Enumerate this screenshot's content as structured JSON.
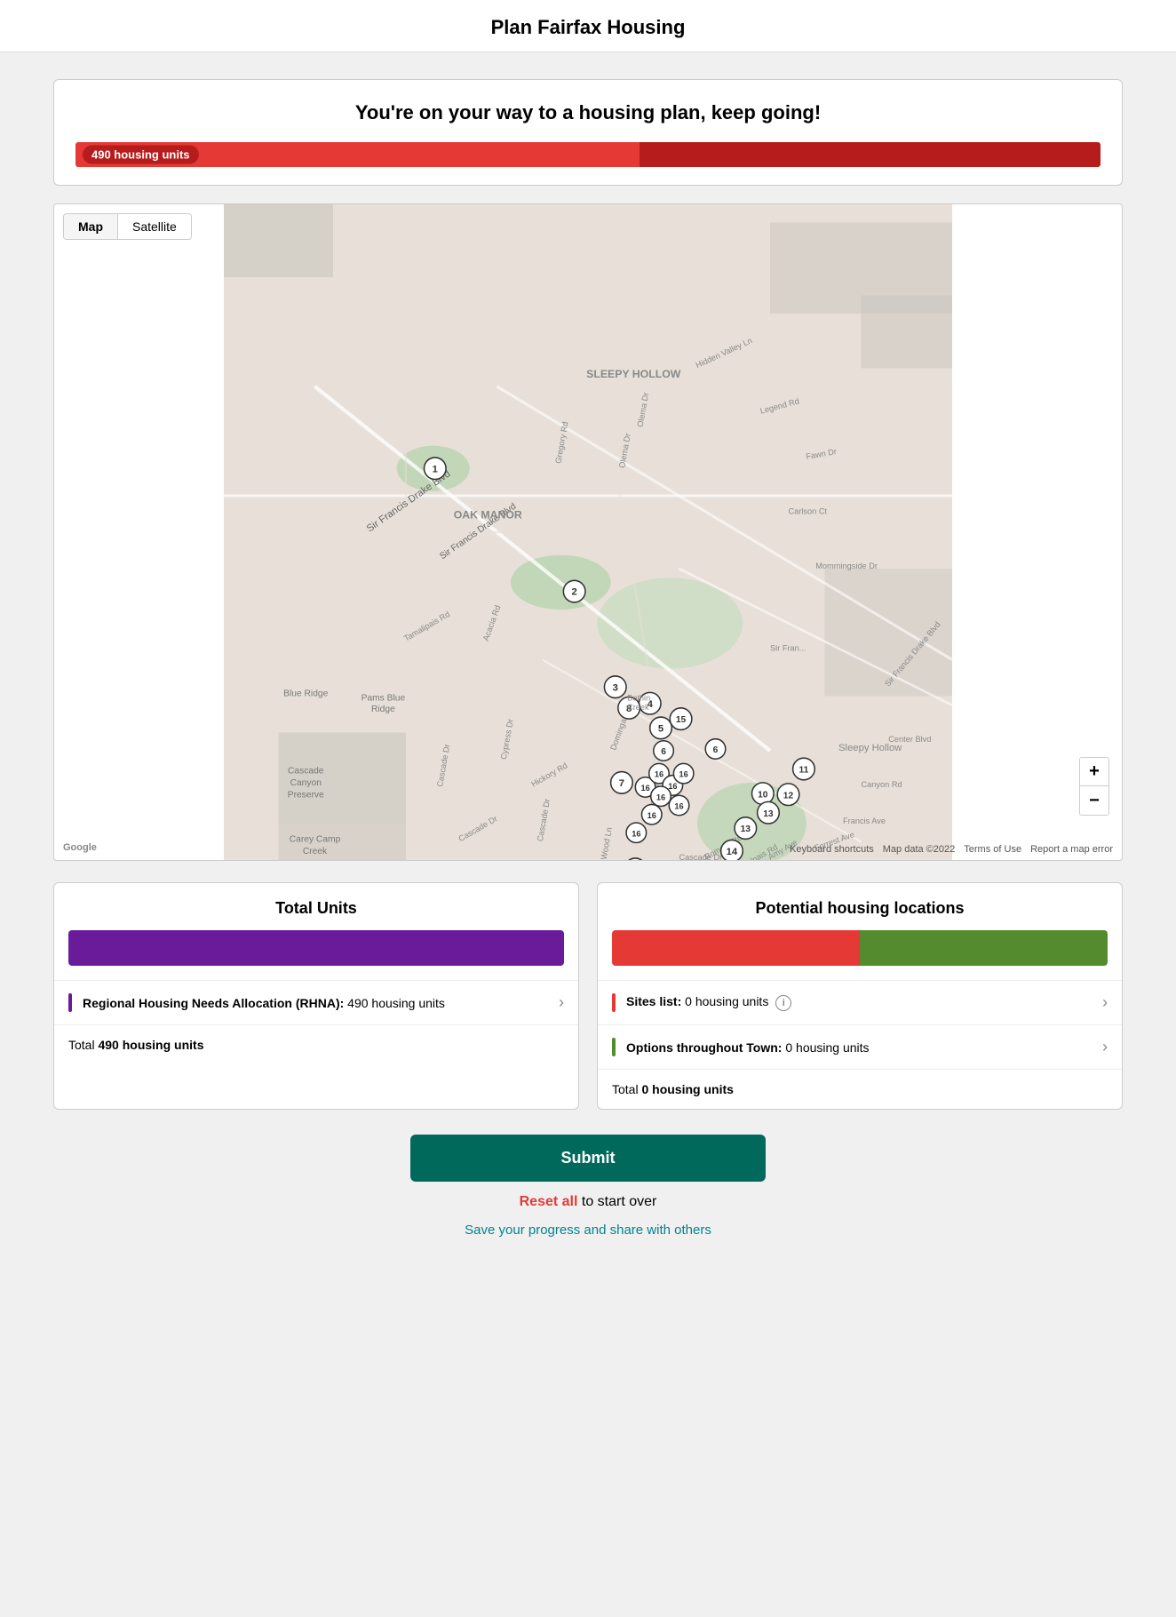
{
  "page": {
    "title": "Plan Fairfax Housing"
  },
  "progress_card": {
    "title": "You're on your way to a housing plan, keep going!",
    "label": "490 housing units"
  },
  "map": {
    "tab_map": "Map",
    "tab_satellite": "Satellite",
    "zoom_in": "+",
    "zoom_out": "−",
    "footer_shortcuts": "Keyboard shortcuts",
    "footer_data": "Map data ©2022",
    "footer_terms": "Terms of Use",
    "footer_error": "Report a map error",
    "google_logo": "Google"
  },
  "total_units": {
    "title": "Total Units",
    "rhna_label": "Regional Housing Needs Allocation (RHNA):",
    "rhna_value": "490 housing units",
    "total_label": "Total",
    "total_value": "490 housing units",
    "arrow": "›"
  },
  "potential_housing": {
    "title": "Potential housing locations",
    "sites_label": "Sites list:",
    "sites_value": "0 housing units",
    "options_label": "Options throughout Town:",
    "options_value": "0 housing units",
    "total_label": "Total",
    "total_value": "0 housing units",
    "arrow": "›"
  },
  "actions": {
    "submit": "Submit",
    "reset_prefix": "",
    "reset_link": "Reset all",
    "reset_suffix": " to start over",
    "save_link": "Save your progress and share with others"
  }
}
